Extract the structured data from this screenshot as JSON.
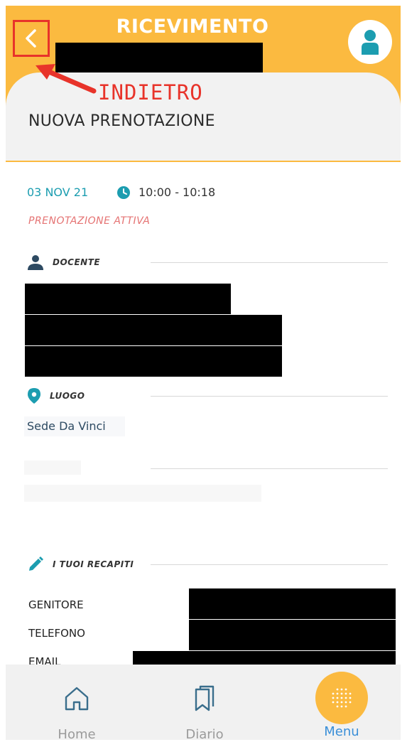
{
  "header": {
    "title": "RICEVIMENTO",
    "annotation": "INDIETRO",
    "page_title": "NUOVA PRENOTAZIONE",
    "icons": {
      "back": "chevron-left-icon",
      "user": "user-icon"
    }
  },
  "booking": {
    "date": "03 NOV 21",
    "time": "10:00 - 10:18",
    "status": "PRENOTAZIONE ATTIVA"
  },
  "sections": {
    "teacher": {
      "label": "DOCENTE",
      "icon": "person-icon"
    },
    "place": {
      "label": "LUOGO",
      "icon": "location-pin-icon",
      "value": "Sede Da Vinci"
    },
    "contacts": {
      "label": "I TUOI RECAPITI",
      "icon": "pencil-icon",
      "fields": [
        "GENITORE",
        "TELEFONO",
        "EMAIL"
      ]
    }
  },
  "nav": {
    "home_label": "Home",
    "diary_label": "Diario",
    "menu_label": "Menu"
  },
  "colors": {
    "header": "#FBBA40",
    "accent_teal": "#1C9DB0",
    "status_red": "#E57373",
    "annotation_red": "#E8332A",
    "menu_active": "#3A8FD8"
  }
}
